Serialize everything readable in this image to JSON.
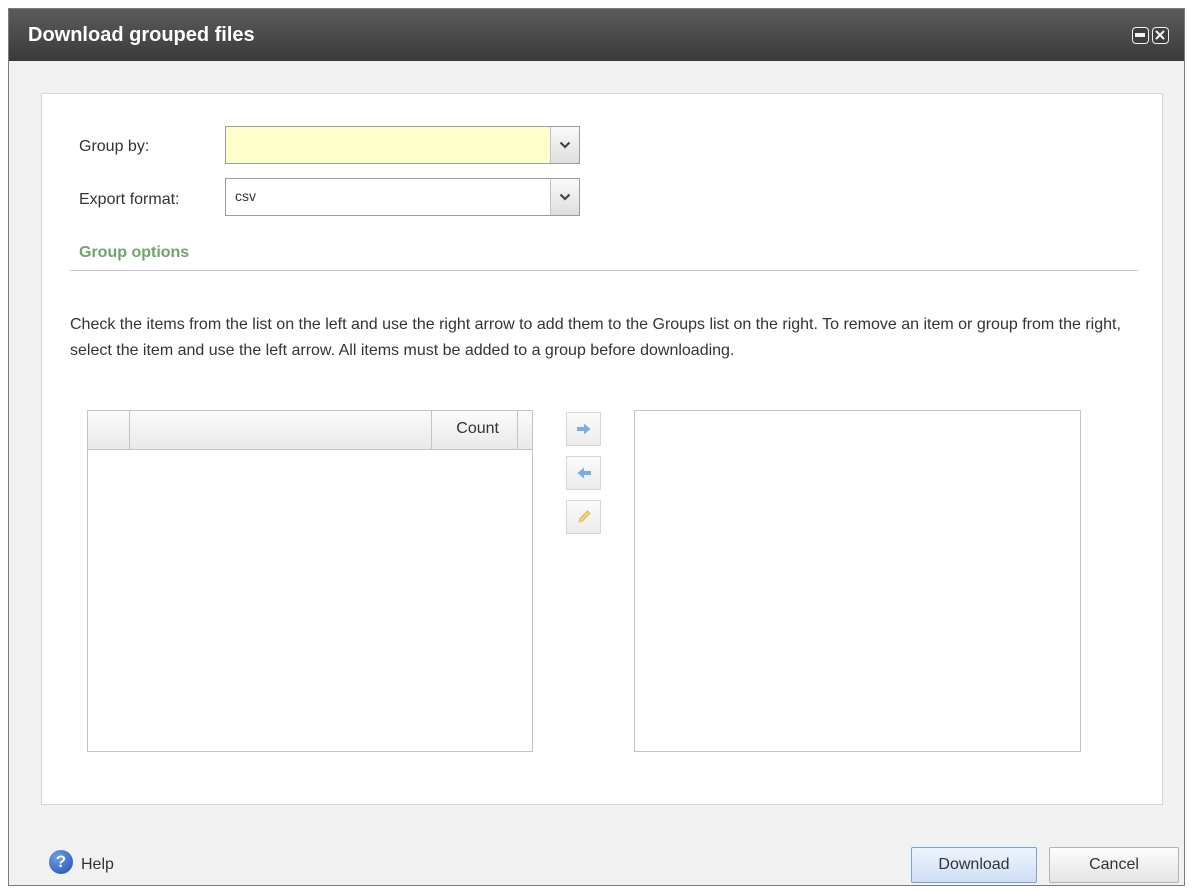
{
  "dialog": {
    "title": "Download grouped files"
  },
  "form": {
    "group_by_label": "Group by:",
    "group_by_value": "",
    "export_format_label": "Export format:",
    "export_format_value": "csv"
  },
  "group_options": {
    "section_title": "Group options",
    "instructions": "Check the items from the list on the left and use the right arrow to add them to the Groups list on the right. To remove an item or group from the right, select the item and use the left arrow. All items must be added to a group before downloading.",
    "grid_columns": [
      "",
      "",
      "Count"
    ],
    "grid_rows": [],
    "groups": []
  },
  "footer": {
    "help_label": "Help",
    "download_label": "Download",
    "cancel_label": "Cancel"
  },
  "colors": {
    "titlebar": "#4a4a4a",
    "section_title": "#6fa36a",
    "group_by_field_bg": "#ffffcc",
    "arrow_icon": "#79aee4",
    "download_button_border": "#7e9fcf"
  },
  "icons": {
    "restore": "restore-icon",
    "close": "close-icon",
    "dropdown": "chevron-down-icon",
    "move_right": "arrow-right-icon",
    "move_left": "arrow-left-icon",
    "edit": "pencil-icon",
    "help": "help-icon"
  }
}
